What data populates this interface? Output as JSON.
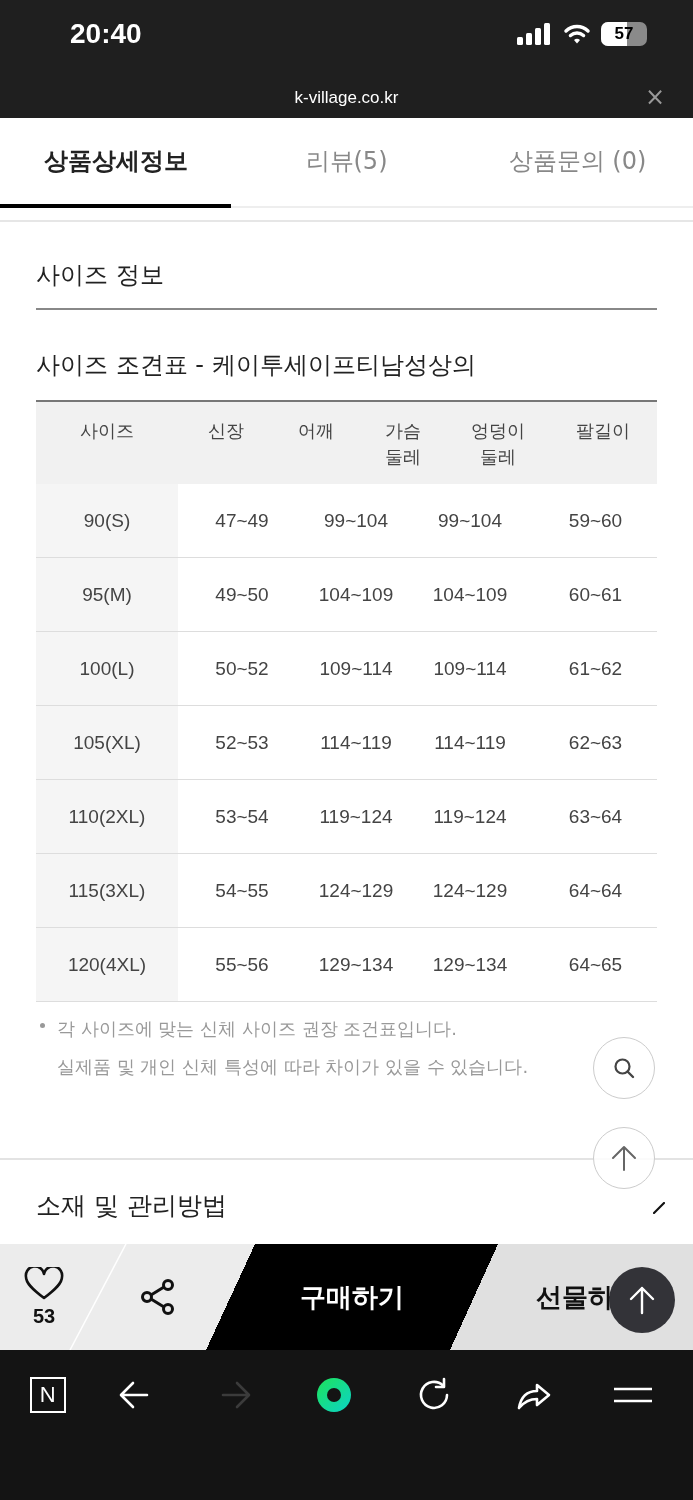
{
  "status_bar": {
    "time": "20:40",
    "battery": {
      "text": "57",
      "level": 0.57
    }
  },
  "browser_bar": {
    "url": "k-village.co.kr",
    "close": "×"
  },
  "tabs": [
    {
      "label": "상품상세정보",
      "selected": true
    },
    {
      "label": "리뷰(5)",
      "selected": false
    },
    {
      "label": "상품문의 (0)",
      "selected": false
    }
  ],
  "size_info": {
    "heading": "사이즈 정보",
    "table_title": "사이즈 조견표 - 케이투세이프티남성상의",
    "header_labels": [
      "사이즈",
      "신장",
      "어깨",
      "가슴\n둘레",
      "엉덩이\n둘레",
      "팔길이"
    ],
    "body_rows": [
      [
        "90(S)",
        "47~49",
        "99~104",
        "99~104",
        "59~60"
      ],
      [
        "95(M)",
        "49~50",
        "104~109",
        "104~109",
        "60~61"
      ],
      [
        "100(L)",
        "50~52",
        "109~114",
        "109~114",
        "61~62"
      ],
      [
        "105(XL)",
        "52~53",
        "114~119",
        "114~119",
        "62~63"
      ],
      [
        "110(2XL)",
        "53~54",
        "119~124",
        "119~124",
        "63~64"
      ],
      [
        "115(3XL)",
        "54~55",
        "124~129",
        "124~129",
        "64~64"
      ],
      [
        "120(4XL)",
        "55~56",
        "129~134",
        "129~134",
        "64~65"
      ]
    ],
    "notes": [
      "각 사이즈에 맞는 신체 사이즈 권장 조건표입니다.",
      "실제품 및 개인 신체 특성에 따라 차이가 있을 수 있습니다."
    ]
  },
  "material_section": {
    "heading": "소재 및 관리방법"
  },
  "action_bar": {
    "like_count": "53",
    "buy": "구매하기",
    "gift": "선물하"
  },
  "toolbar": [
    {
      "kind": "naver",
      "label": "N",
      "disabled": false
    },
    {
      "kind": "back",
      "disabled": false
    },
    {
      "kind": "forward",
      "disabled": true
    },
    {
      "kind": "home",
      "disabled": false
    },
    {
      "kind": "reload",
      "disabled": false
    },
    {
      "kind": "share",
      "disabled": false
    },
    {
      "kind": "menu",
      "disabled": false
    }
  ]
}
